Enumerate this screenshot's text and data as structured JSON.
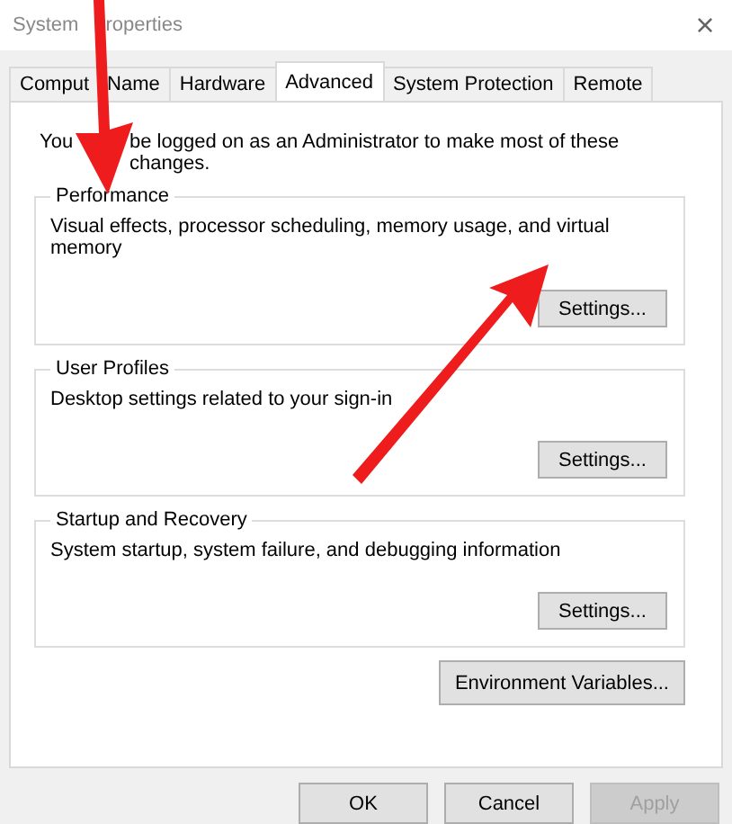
{
  "window": {
    "title": "System",
    "title_after": "roperties",
    "close": "×"
  },
  "tabs": [
    {
      "label": "Comput",
      "label_after": "Name",
      "selected": false
    },
    {
      "label": "Hardware",
      "selected": false
    },
    {
      "label": "Advanced",
      "selected": true
    },
    {
      "label": "System Protection",
      "selected": false
    },
    {
      "label": "Remote",
      "selected": false
    }
  ],
  "notice": "You",
  "notice_after": "be logged on as an Administrator to make most of these changes.",
  "groups": [
    {
      "title": "Performance",
      "description": "Visual effects, processor scheduling, memory usage, and virtual memory",
      "button": "Settings..."
    },
    {
      "title": "User Profiles",
      "description": "Desktop settings related to your sign-in",
      "button": "Settings..."
    },
    {
      "title": "Startup and Recovery",
      "description": "System startup, system failure, and debugging information",
      "button": "Settings..."
    }
  ],
  "environment_button": "Environment Variables...",
  "buttons": [
    {
      "label": "OK",
      "disabled": false
    },
    {
      "label": "Cancel",
      "disabled": false
    },
    {
      "label": "Apply",
      "disabled": true
    }
  ]
}
